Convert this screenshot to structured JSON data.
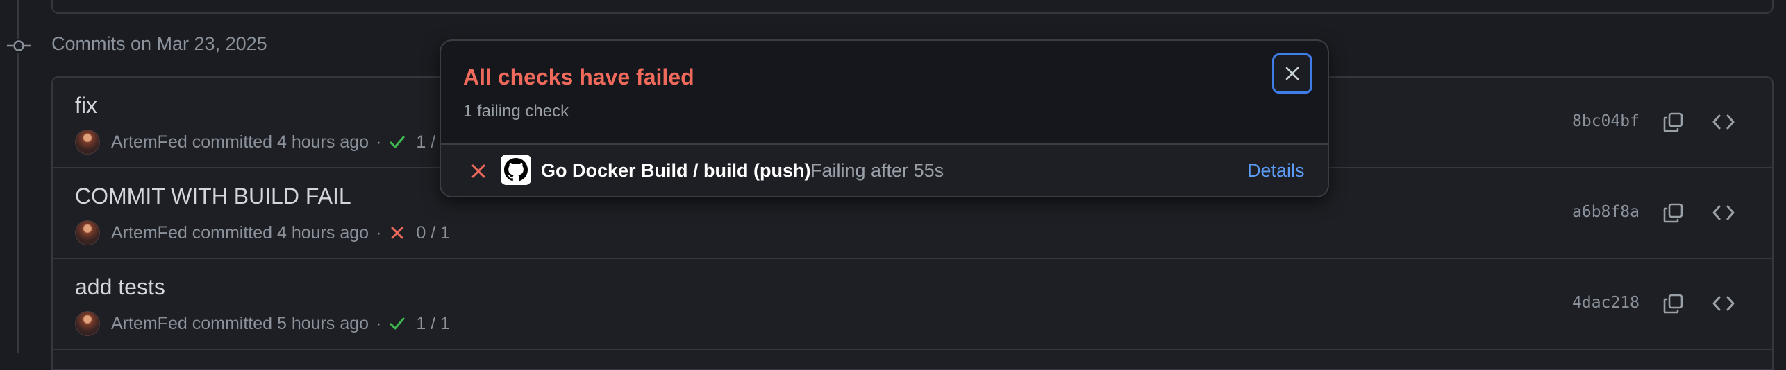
{
  "timeline": {
    "date_heading": "Commits on Mar 23, 2025"
  },
  "commits": [
    {
      "title": "fix",
      "author": "ArtemFed",
      "action": "committed",
      "time": "4 hours ago",
      "sep": "·",
      "status": "success",
      "checks": "1 / 1",
      "sha": "8bc04bf"
    },
    {
      "title": "COMMIT WITH BUILD FAIL",
      "author": "ArtemFed",
      "action": "committed",
      "time": "4 hours ago",
      "sep": "·",
      "status": "failure",
      "checks": "0 / 1",
      "sha": "a6b8f8a"
    },
    {
      "title": "add tests",
      "author": "ArtemFed",
      "action": "committed",
      "time": "5 hours ago",
      "sep": "·",
      "status": "success",
      "checks": "1 / 1",
      "sha": "4dac218"
    }
  ],
  "popover": {
    "title": "All checks have failed",
    "subtitle": "1 failing check",
    "check": {
      "name": "Go Docker Build / build (push)",
      "status": "Failing after 55s",
      "details_label": "Details"
    }
  },
  "colors": {
    "failure": "#f06a5c",
    "success": "#3fb950",
    "link": "#5b9cf5",
    "focus": "#3f7ee8"
  },
  "icons": {
    "timeline": "git-commit-icon",
    "avatar": "avatar",
    "success": "check-icon",
    "failure": "x-icon",
    "copy": "copy-icon",
    "browse": "code-icon",
    "close": "close-icon",
    "app": "github-logo-icon"
  }
}
